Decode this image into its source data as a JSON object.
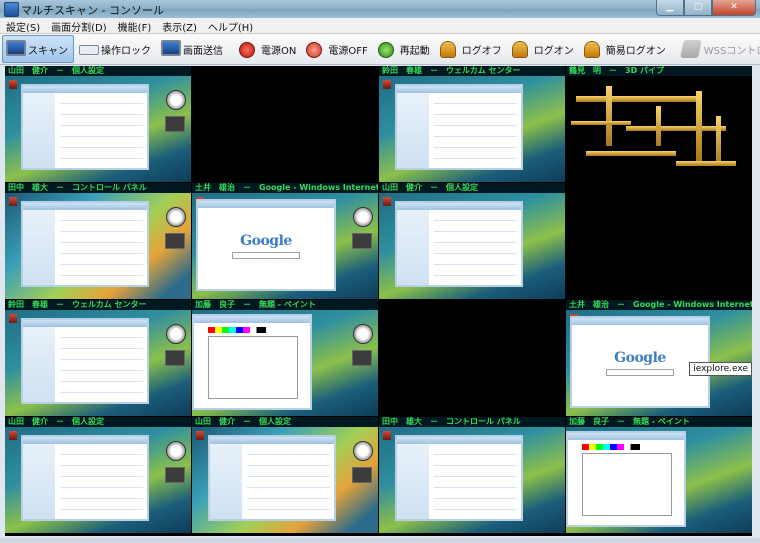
{
  "window": {
    "title": "マルチスキャン - コンソール"
  },
  "menu": [
    "設定(S)",
    "画面分割(D)",
    "機能(F)",
    "表示(Z)",
    "ヘルプ(H)"
  ],
  "toolbar": [
    {
      "label": "スキャン",
      "icon": "monitor-icon",
      "active": true,
      "disabled": false
    },
    {
      "label": "操作ロック",
      "icon": "keyboard-icon",
      "active": false,
      "disabled": false
    },
    {
      "label": "画面送信",
      "icon": "monitor-send-icon",
      "active": false,
      "disabled": false
    },
    {
      "label": "電源ON",
      "icon": "power-on-icon",
      "active": false,
      "disabled": false
    },
    {
      "label": "電源OFF",
      "icon": "power-off-icon",
      "active": false,
      "disabled": false
    },
    {
      "label": "再起動",
      "icon": "restart-icon",
      "active": false,
      "disabled": false
    },
    {
      "label": "ログオフ",
      "icon": "logoff-icon",
      "active": false,
      "disabled": false
    },
    {
      "label": "ログオン",
      "icon": "logon-icon",
      "active": false,
      "disabled": false
    },
    {
      "label": "簡易ログオン",
      "icon": "quick-logon-icon",
      "active": false,
      "disabled": false
    },
    {
      "label": "WSSコントローラ",
      "icon": "wss-controller-icon",
      "active": false,
      "disabled": true
    }
  ],
  "grid": {
    "label_color": "#36d95a",
    "cells": [
      {
        "label": "山田　健介　－　個人設定",
        "screen": "vista-window"
      },
      {
        "label": "",
        "screen": "blank"
      },
      {
        "label": "鈴田　春雄　－　ウェルカム センター",
        "screen": "vista-window"
      },
      {
        "label": "鶴見　明　－　3D パイプ",
        "screen": "pipes"
      },
      {
        "label": "田中　雄大　－　コントロール パネル",
        "screen": "vista-window"
      },
      {
        "label": "土井　雄治　－　Google - Windows Internet",
        "screen": "google"
      },
      {
        "label": "山田　健介　－　個人設定",
        "screen": "vista-window"
      },
      {
        "label": "",
        "screen": "blank"
      },
      {
        "label": "鈴田　春雄　－　ウェルカム センター",
        "screen": "vista-window"
      },
      {
        "label": "加藤　良子　－　無題 - ペイント",
        "screen": "paint"
      },
      {
        "label": "",
        "screen": "blank"
      },
      {
        "label": "土井　雄治　－　Google - Windows Internet",
        "screen": "google",
        "tooltip": "iexplore.exe"
      },
      {
        "label": "山田　健介　－　個人設定",
        "screen": "vista-window"
      },
      {
        "label": "山田　健介　－　個人設定",
        "screen": "vista-window"
      },
      {
        "label": "田中　雄大　－　コントロール パネル",
        "screen": "vista-window"
      },
      {
        "label": "加藤　良子　－　無題 - ペイント",
        "screen": "paint"
      }
    ]
  },
  "google_logo": "Google"
}
